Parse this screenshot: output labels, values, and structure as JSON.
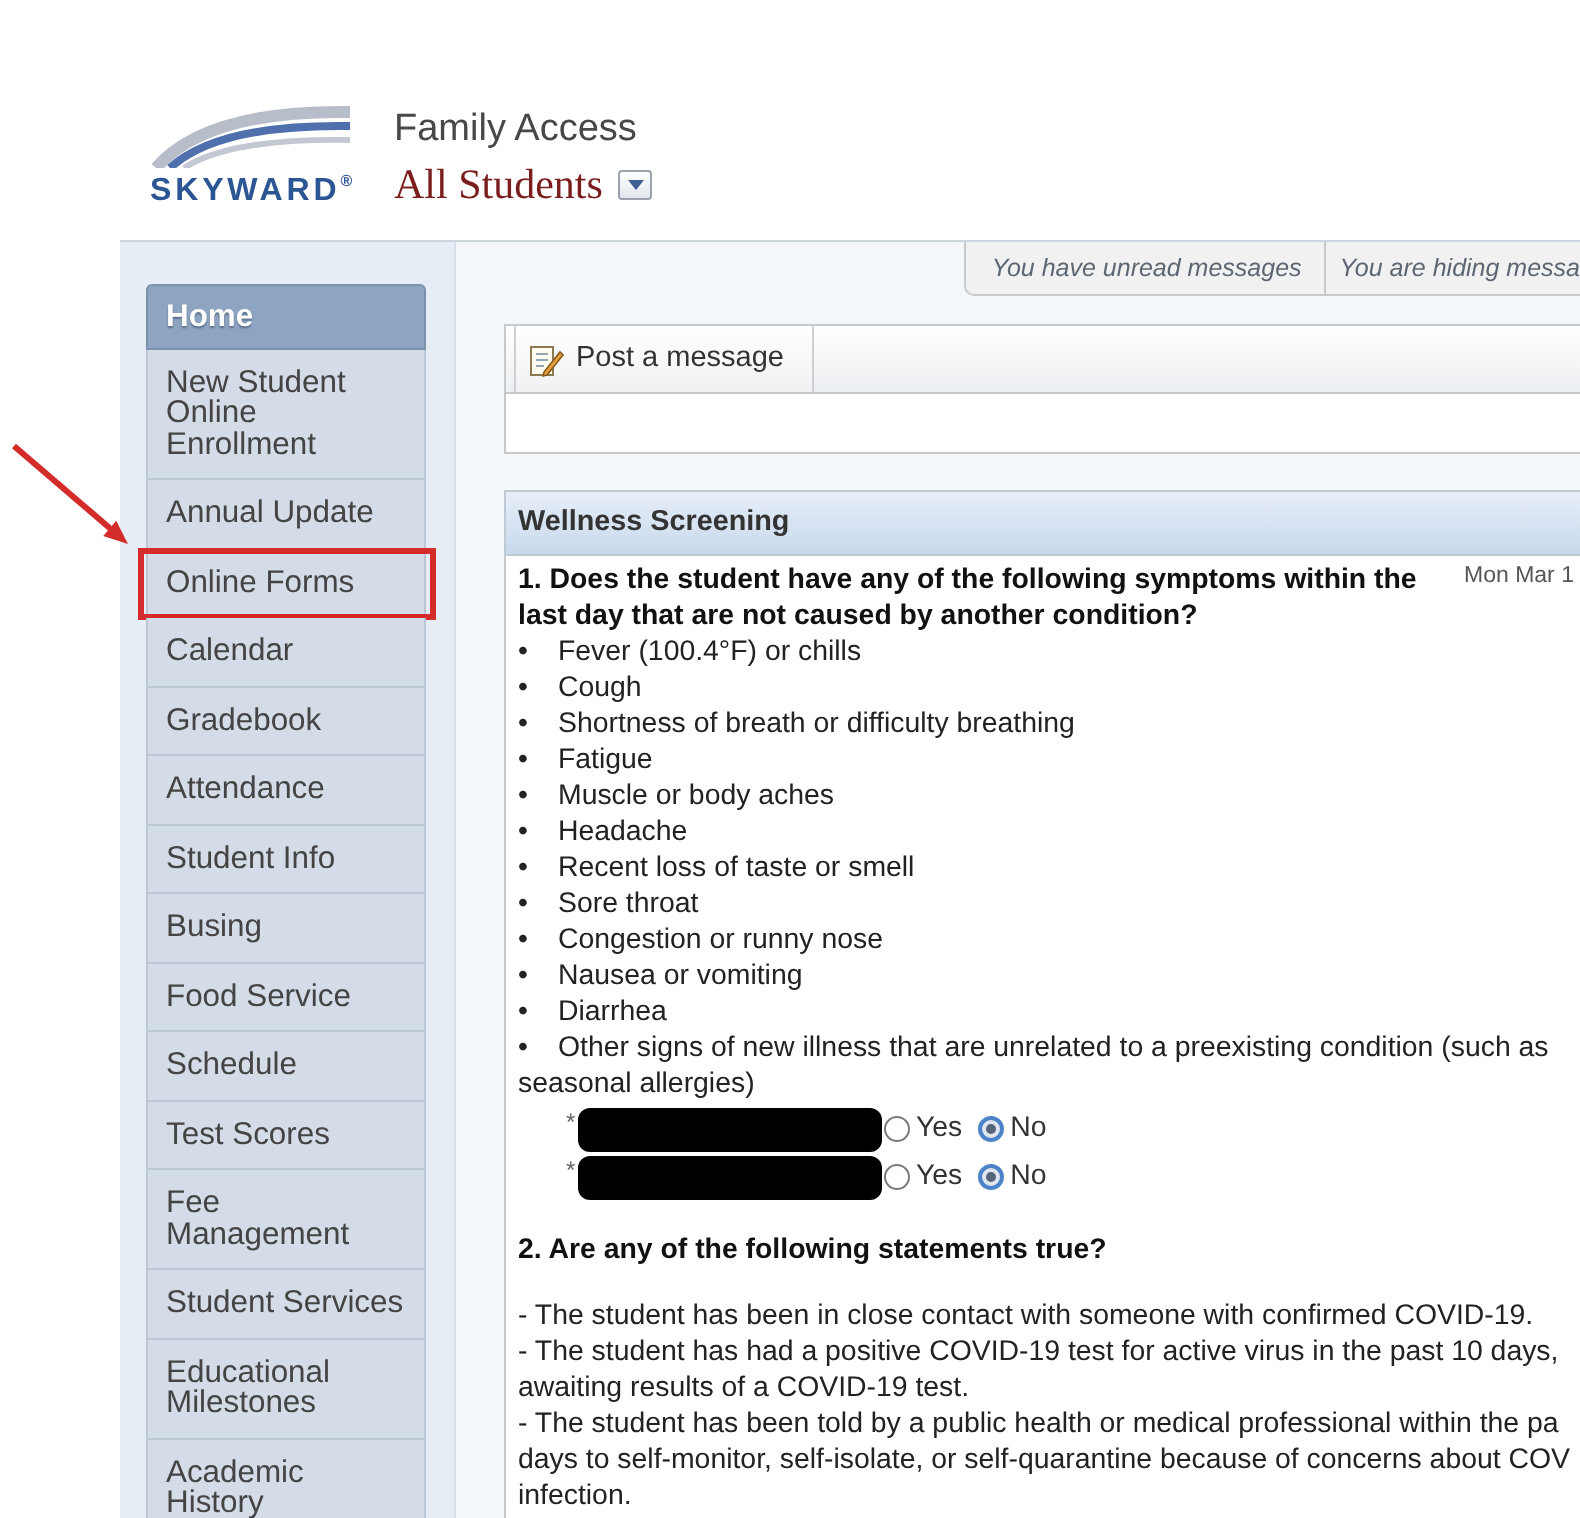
{
  "header": {
    "logo_text": "SKYWARD$^{®}$",
    "app_title": "Family Access",
    "student_selector": "All Students"
  },
  "message_tabs": [
    "You have unread messages",
    "You are hiding messa"
  ],
  "sidebar": {
    "items": [
      {
        "label": "Home",
        "selected": true,
        "highlighted": false
      },
      {
        "label": "New Student Online Enrollment",
        "selected": false,
        "highlighted": false
      },
      {
        "label": "Annual Update",
        "selected": false,
        "highlighted": false
      },
      {
        "label": "Online Forms",
        "selected": false,
        "highlighted": true
      },
      {
        "label": "Calendar",
        "selected": false,
        "highlighted": false
      },
      {
        "label": "Gradebook",
        "selected": false,
        "highlighted": false
      },
      {
        "label": "Attendance",
        "selected": false,
        "highlighted": false
      },
      {
        "label": "Student Info",
        "selected": false,
        "highlighted": false
      },
      {
        "label": "Busing",
        "selected": false,
        "highlighted": false
      },
      {
        "label": "Food Service",
        "selected": false,
        "highlighted": false
      },
      {
        "label": "Schedule",
        "selected": false,
        "highlighted": false
      },
      {
        "label": "Test Scores",
        "selected": false,
        "highlighted": false
      },
      {
        "label": "Fee Management",
        "selected": false,
        "highlighted": false
      },
      {
        "label": "Student Services",
        "selected": false,
        "highlighted": false
      },
      {
        "label": "Educational Milestones",
        "selected": false,
        "highlighted": false
      },
      {
        "label": "Academic History",
        "selected": false,
        "highlighted": false
      }
    ]
  },
  "post_message": {
    "button": "Post a message"
  },
  "wellness": {
    "title": "Wellness Screening",
    "date": "Mon Mar 1",
    "questions": [
      {
        "kind": "symptoms",
        "text": "1. Does the student have any of the following symptoms within the last day that are not caused by another condition?",
        "items": [
          "•\tFever (100.4°F) or chills",
          "•\tCough",
          "•\tShortness of breath or difficulty breathing",
          "•\tFatigue",
          "•\tMuscle or body aches",
          "•\tHeadache",
          "•\tRecent loss of taste or smell",
          "•\tSore throat",
          "•\tCongestion or runny nose",
          "•\tNausea or vomiting",
          "•\tDiarrhea",
          "•\tOther signs of new illness that are unrelated to a preexisting condition (such as seasonal allergies)"
        ],
        "answers": [
          {
            "required_mark": "*",
            "options": [
              {
                "label": "Yes",
                "selected": false
              },
              {
                "label": "No",
                "selected": true
              }
            ]
          },
          {
            "required_mark": "*",
            "options": [
              {
                "label": "Yes",
                "selected": false
              },
              {
                "label": "No",
                "selected": true
              }
            ]
          }
        ]
      },
      {
        "kind": "statements",
        "text": "2. Are any of the following statements true?",
        "items": [
          {
            "lines": [
              "- The student has been in close contact with someone with confirmed COVID-19."
            ]
          },
          {
            "lines": [
              "- The student has had a positive COVID-19 test for active virus in the past 10 days,",
              "awaiting results of a COVID-19 test."
            ]
          },
          {
            "lines": [
              "- The student has been told by a public health or medical professional within the pa",
              "days to self-monitor, self-isolate, or self-quarantine because of concerns about COV",
              "infection."
            ]
          }
        ]
      }
    ]
  }
}
